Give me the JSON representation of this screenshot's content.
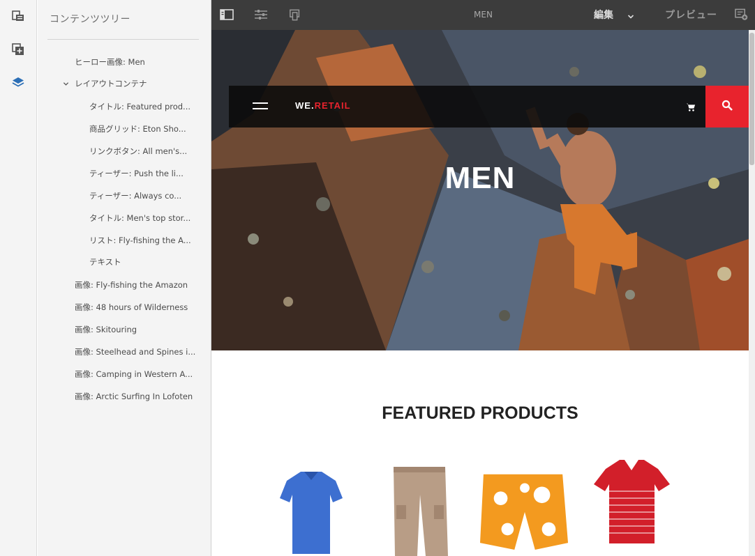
{
  "panel": {
    "title": "コンテンツツリー",
    "tree": [
      {
        "label": "ヒーロー画像: Men",
        "level": 1
      },
      {
        "label": "レイアウトコンテナ",
        "level": 1,
        "expanded": true
      },
      {
        "label": "タイトル: Featured prod...",
        "level": 2
      },
      {
        "label": "商品グリッド: Eton Sho...",
        "level": 2
      },
      {
        "label": "リンクボタン: All men's...",
        "level": 2
      },
      {
        "label": "ティーザー: Push the li...",
        "level": 2
      },
      {
        "label": "ティーザー: Always co...",
        "level": 2
      },
      {
        "label": "タイトル: Men's top stor...",
        "level": 2
      },
      {
        "label": "リスト: Fly-fishing the A...",
        "level": 2
      },
      {
        "label": "テキスト",
        "level": 2
      },
      {
        "label": "画像: Fly-fishing the Amazon",
        "level": 1
      },
      {
        "label": "画像: 48 hours of Wilderness",
        "level": 1
      },
      {
        "label": "画像: Skitouring",
        "level": 1
      },
      {
        "label": "画像: Steelhead and Spines i...",
        "level": 1
      },
      {
        "label": "画像: Camping in Western A...",
        "level": 1
      },
      {
        "label": "画像: Arctic Surfing In Lofoten",
        "level": 1
      }
    ]
  },
  "rail": {
    "icons": [
      "page-properties-icon",
      "components-icon",
      "layers-icon"
    ],
    "active": "layers-icon"
  },
  "toolbar": {
    "page_title": "MEN",
    "mode_label": "編集",
    "preview_label": "プレビュー",
    "icons": [
      "toggle-side-panel-icon",
      "page-settings-icon",
      "emulator-icon",
      "annotations-icon"
    ]
  },
  "site": {
    "brand_prefix": "WE.",
    "brand_suffix": "RETAIL",
    "hero_title": "MEN",
    "section_title": "FEATURED PRODUCTS",
    "products": [
      "blue-polo-shirt",
      "khaki-cargo-pants",
      "orange-floral-board-shorts",
      "red-striped-polo-shirt"
    ]
  },
  "colors": {
    "accent_red": "#e8232d",
    "toolbar_bg": "#3c3c3c",
    "panel_bg": "#f4f4f4",
    "active_icon": "#2c6fb6"
  }
}
